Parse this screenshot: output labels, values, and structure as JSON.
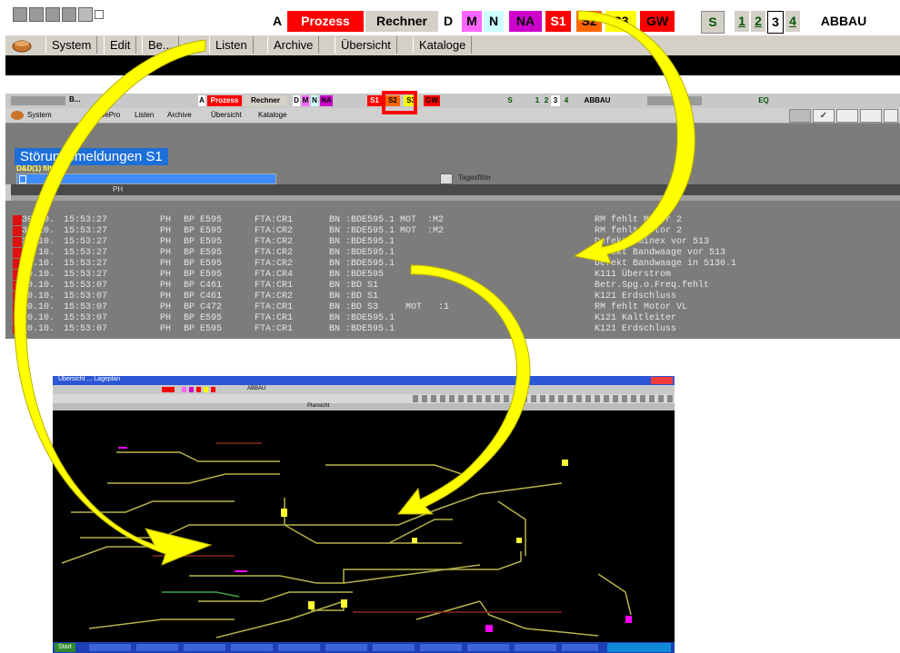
{
  "top": {
    "toolbar": [
      {
        "label": "A",
        "bg": "#ffffff",
        "fg": "#000000"
      },
      {
        "label": "Prozess",
        "bg": "#ff0000",
        "fg": "#ffffff"
      },
      {
        "label": "Rechner",
        "bg": "#d4d0c8",
        "fg": "#000000"
      },
      {
        "label": "D",
        "bg": "#ffffff",
        "fg": "#000000"
      },
      {
        "label": "M",
        "bg": "#ff66ff",
        "fg": "#000000"
      },
      {
        "label": "N",
        "bg": "#ccffff",
        "fg": "#000000"
      },
      {
        "label": "NA",
        "bg": "#cc00cc",
        "fg": "#000000"
      },
      {
        "label": "S1",
        "bg": "#ff0000",
        "fg": "#ffffff"
      },
      {
        "label": "S2",
        "bg": "#ff6600",
        "fg": "#000000"
      },
      {
        "label": "S3",
        "bg": "#ffff00",
        "fg": "#000000"
      },
      {
        "label": "GW",
        "bg": "#ff0000",
        "fg": "#000000"
      }
    ],
    "s_label": "S",
    "views": [
      "1",
      "2",
      "3",
      "4"
    ],
    "abbau": "ABBAU",
    "menu": [
      "System",
      "Edit",
      "Be...",
      "Listen",
      "Archive",
      "Übersicht",
      "Kataloge"
    ]
  },
  "mid": {
    "window_title": "B...",
    "toolbar": [
      "A",
      "Prozess",
      "Rechner",
      "D",
      "M",
      "N",
      "NA",
      "S1",
      "S2",
      "S3",
      "GW"
    ],
    "s_label": "S",
    "views": [
      "1",
      "2",
      "3",
      "4"
    ],
    "abbau": "ABBAU",
    "eq": "EQ",
    "menu": [
      "System",
      "",
      "BePro",
      "Listen",
      "Archive",
      "Übersicht",
      "Kataloge"
    ],
    "panel_title": "Störungsmeldungen S1",
    "filter_label": "D&D(1) filtern",
    "tagesfilter": "Tagesfilter",
    "column": "PH",
    "rows": [
      {
        "d": "30.10.",
        "t": "15:53:27",
        "a": "PH",
        "b": "BP E595",
        "c": "FTA:CR1",
        "e": "BN :BDE595.1 MOT  :M2",
        "m": "RM fehlt Motor 2"
      },
      {
        "d": "30.10.",
        "t": "15:53:27",
        "a": "PH",
        "b": "BP E595",
        "c": "FTA:CR2",
        "e": "BN :BDE595.1 MOT  :M2",
        "m": "RM fehlt Motor 2"
      },
      {
        "d": "30.10.",
        "t": "15:53:27",
        "a": "PH",
        "b": "BP E595",
        "c": "FTA:CR2",
        "e": "BN :BDE595.1",
        "m": "Defekt Uminex vor 513"
      },
      {
        "d": "30.10.",
        "t": "15:53:27",
        "a": "PH",
        "b": "BP E595",
        "c": "FTA:CR2",
        "e": "BN :BDE595.1",
        "m": "Defekt Bandwaage vor 513"
      },
      {
        "d": "30.10.",
        "t": "15:53:27",
        "a": "PH",
        "b": "BP E595",
        "c": "FTA:CR2",
        "e": "BN :BDE595.1",
        "m": "Defekt Bandwaage in 5130.1"
      },
      {
        "d": "30.10.",
        "t": "15:53:27",
        "a": "PH",
        "b": "BP E595",
        "c": "FTA:CR4",
        "e": "BN :BDE595",
        "m": "K111 Überstrom"
      },
      {
        "d": "30.10.",
        "t": "15:53:07",
        "a": "PH",
        "b": "BP C461",
        "c": "FTA:CR1",
        "e": "BN :BD S1",
        "m": "Betr.Spg.o.Freq.fehlt"
      },
      {
        "d": "30.10.",
        "t": "15:53:07",
        "a": "PH",
        "b": "BP C461",
        "c": "FTA:CR2",
        "e": "BN :BD S1",
        "m": "K121 Erdschluss"
      },
      {
        "d": "30.10.",
        "t": "15:53:07",
        "a": "PH",
        "b": "BP C472",
        "c": "FTA:CR1",
        "e": "BN :BD S3     MOT   :1",
        "m": "RM fehlt Motor VL"
      },
      {
        "d": "30.10.",
        "t": "15:53:07",
        "a": "PH",
        "b": "BP E595",
        "c": "FTA:CR1",
        "e": "BN :BDE595.1",
        "m": "K121 Kaltleiter"
      },
      {
        "d": "30.10.",
        "t": "15:53:07",
        "a": "PH",
        "b": "BP E595",
        "c": "FTA:CR1",
        "e": "BN :BDE595.1",
        "m": "K121 Erdschluss"
      }
    ]
  },
  "map": {
    "title": "Übersicht ... Lageplan",
    "subtitle": "Plansicht",
    "start": "Start",
    "abbau": "ABBAU"
  },
  "colors": {
    "track": "#b7b24a",
    "node": "#ffff33",
    "alarm": "#ff00ff",
    "arrow": "#ffff00",
    "accent_red": "#ff0000"
  }
}
